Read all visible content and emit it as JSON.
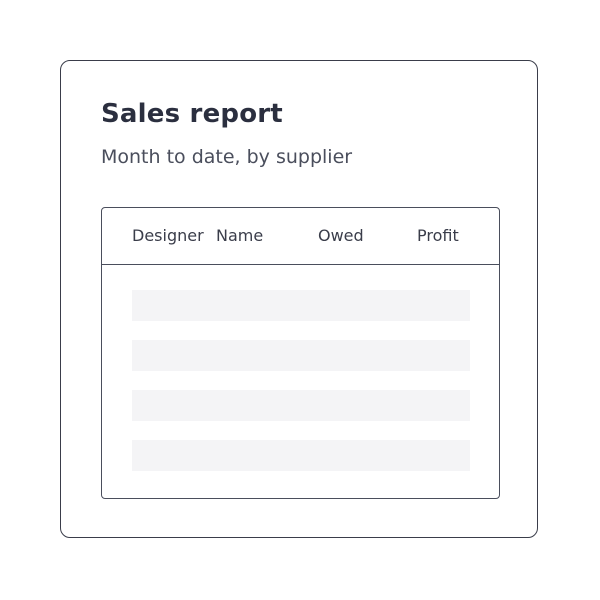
{
  "report": {
    "title": "Sales report",
    "subtitle": "Month to date, by supplier"
  },
  "table": {
    "columns": [
      "Designer",
      "Name",
      "Owed",
      "Profit"
    ],
    "rows": [
      {
        "state": "loading-placeholder"
      },
      {
        "state": "loading-placeholder"
      },
      {
        "state": "loading-placeholder"
      },
      {
        "state": "loading-placeholder"
      }
    ]
  },
  "colors": {
    "text_primary": "#2b2f3f",
    "text_secondary": "#4a4e5c",
    "border": "#3a3d4a",
    "placeholder": "#f4f4f6"
  }
}
